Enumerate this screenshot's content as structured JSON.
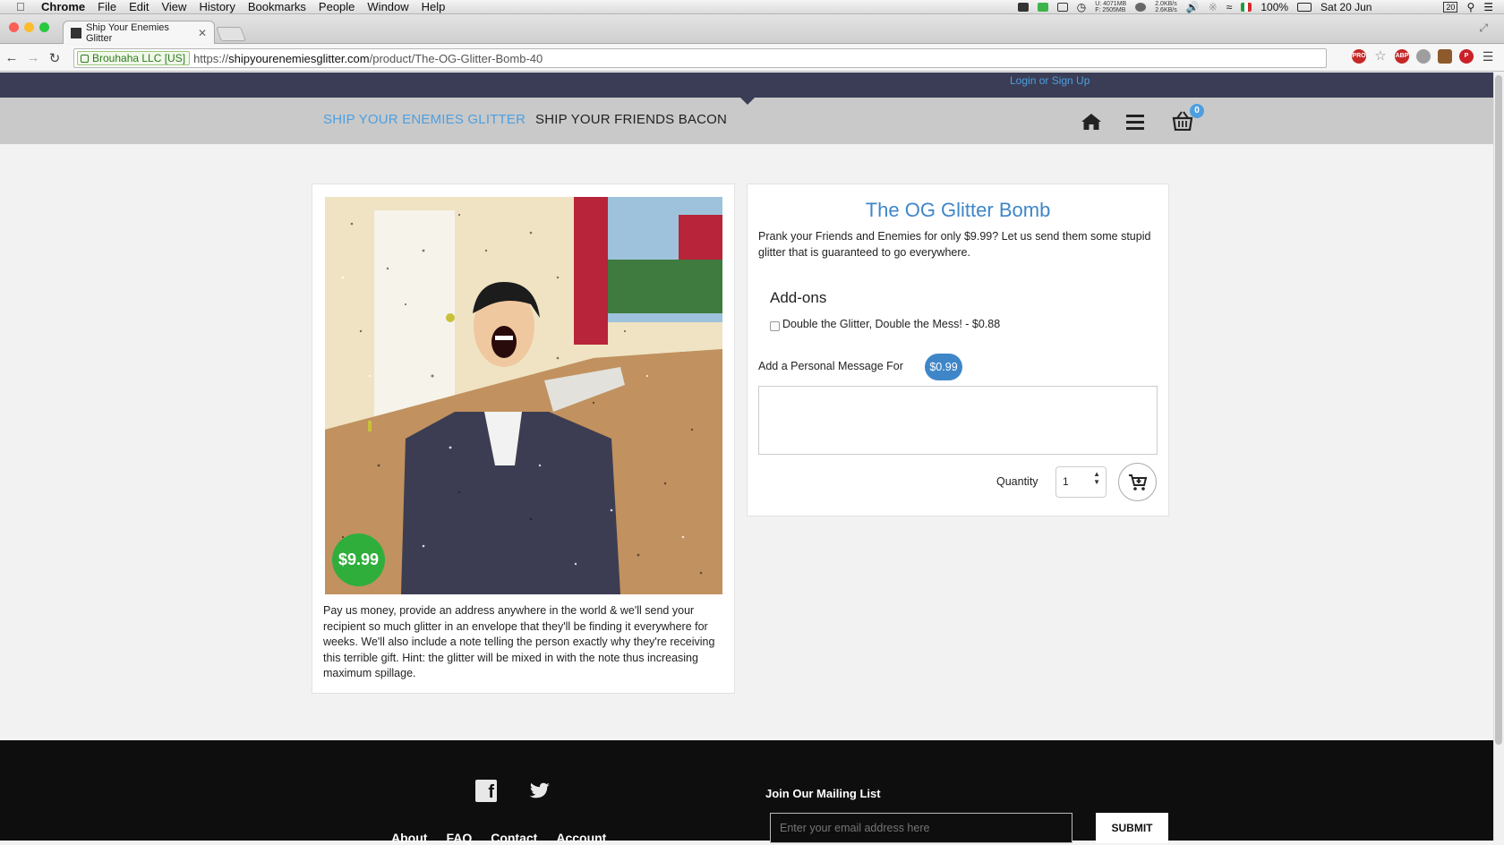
{
  "menubar": {
    "app": "Chrome",
    "items": [
      "File",
      "Edit",
      "View",
      "History",
      "Bookmarks",
      "People",
      "Window",
      "Help"
    ],
    "status": {
      "mem_u": "U: 4071MB",
      "mem_f": "F: 2505MB",
      "net_up": "2.0KB/s",
      "net_down": "2.6KB/s",
      "battery": "100%",
      "date": "Sat 20 Jun",
      "day_icon": "20"
    }
  },
  "browser": {
    "tab_title": "Ship Your Enemies Glitter",
    "ev_label": "Brouhaha LLC [US]",
    "url_scheme": "https://",
    "url_host": "shipyourenemiesglitter.com",
    "url_path": "/product/The-OG-Glitter-Bomb-40"
  },
  "site": {
    "login": "Login or Sign Up",
    "nav": {
      "glitter": "SHIP YOUR ENEMIES GLITTER",
      "bacon": "SHIP YOUR FRIENDS BACON",
      "cart_count": "0"
    },
    "accent": "#4d9fe0",
    "product": {
      "price_badge": "$9.99",
      "description": "Pay us money, provide an address anywhere in the world & we'll send your recipient so much glitter in an envelope that they'll be finding it everywhere for weeks. We'll also include a note telling the person exactly why they're receiving this terrible gift. Hint: the glitter will be mixed in with the note thus increasing maximum spillage.",
      "title": "The OG Glitter Bomb",
      "tagline": "Prank your Friends and Enemies for only $9.99? Let us send them some stupid glitter that is guaranteed to go everywhere.",
      "addons_heading": "Add-ons",
      "addon_label": "Double the Glitter, Double the Mess! - $0.88",
      "message_label": "Add a Personal Message For",
      "message_price": "$0.99",
      "message_value": "",
      "quantity_label": "Quantity",
      "quantity_value": "1"
    },
    "footer": {
      "links": [
        "About",
        "FAQ",
        "Contact",
        "Account"
      ],
      "mailing_title": "Join Our Mailing List",
      "email_placeholder": "Enter your email address here",
      "submit": "SUBMIT"
    }
  }
}
